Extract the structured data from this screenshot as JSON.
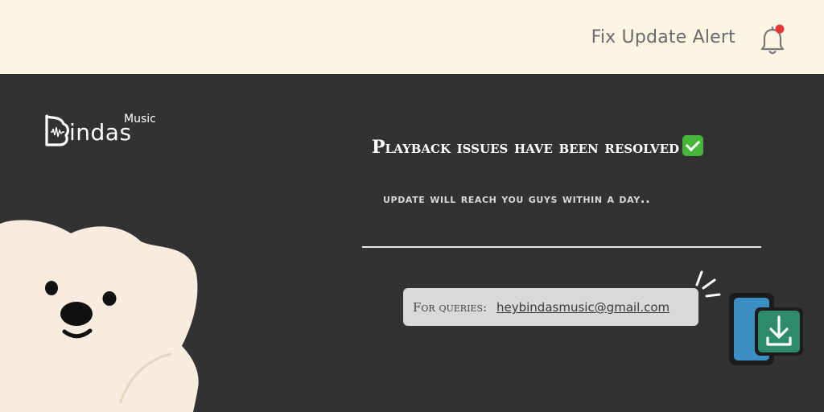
{
  "header": {
    "title": "Fix Update Alert",
    "notification_icon": "bell-icon",
    "notification_dot_color": "#e53935"
  },
  "logo": {
    "word": "indas",
    "superscript": "Music"
  },
  "main": {
    "headline": "Playback issues have been resolved",
    "headline_icon": "check-mark-icon",
    "subline": "update will reach you guys within a day..",
    "query_label": "For queries:",
    "query_email": "heybindasmusic@gmail.com"
  },
  "illustrations": {
    "mascot": "bear-illustration",
    "download": "phone-download-icon"
  },
  "colors": {
    "header_bg": "#fdf5e4",
    "body_bg": "#323232",
    "query_box_bg": "#d9d9d9",
    "bear_fill": "#f8ecde"
  }
}
